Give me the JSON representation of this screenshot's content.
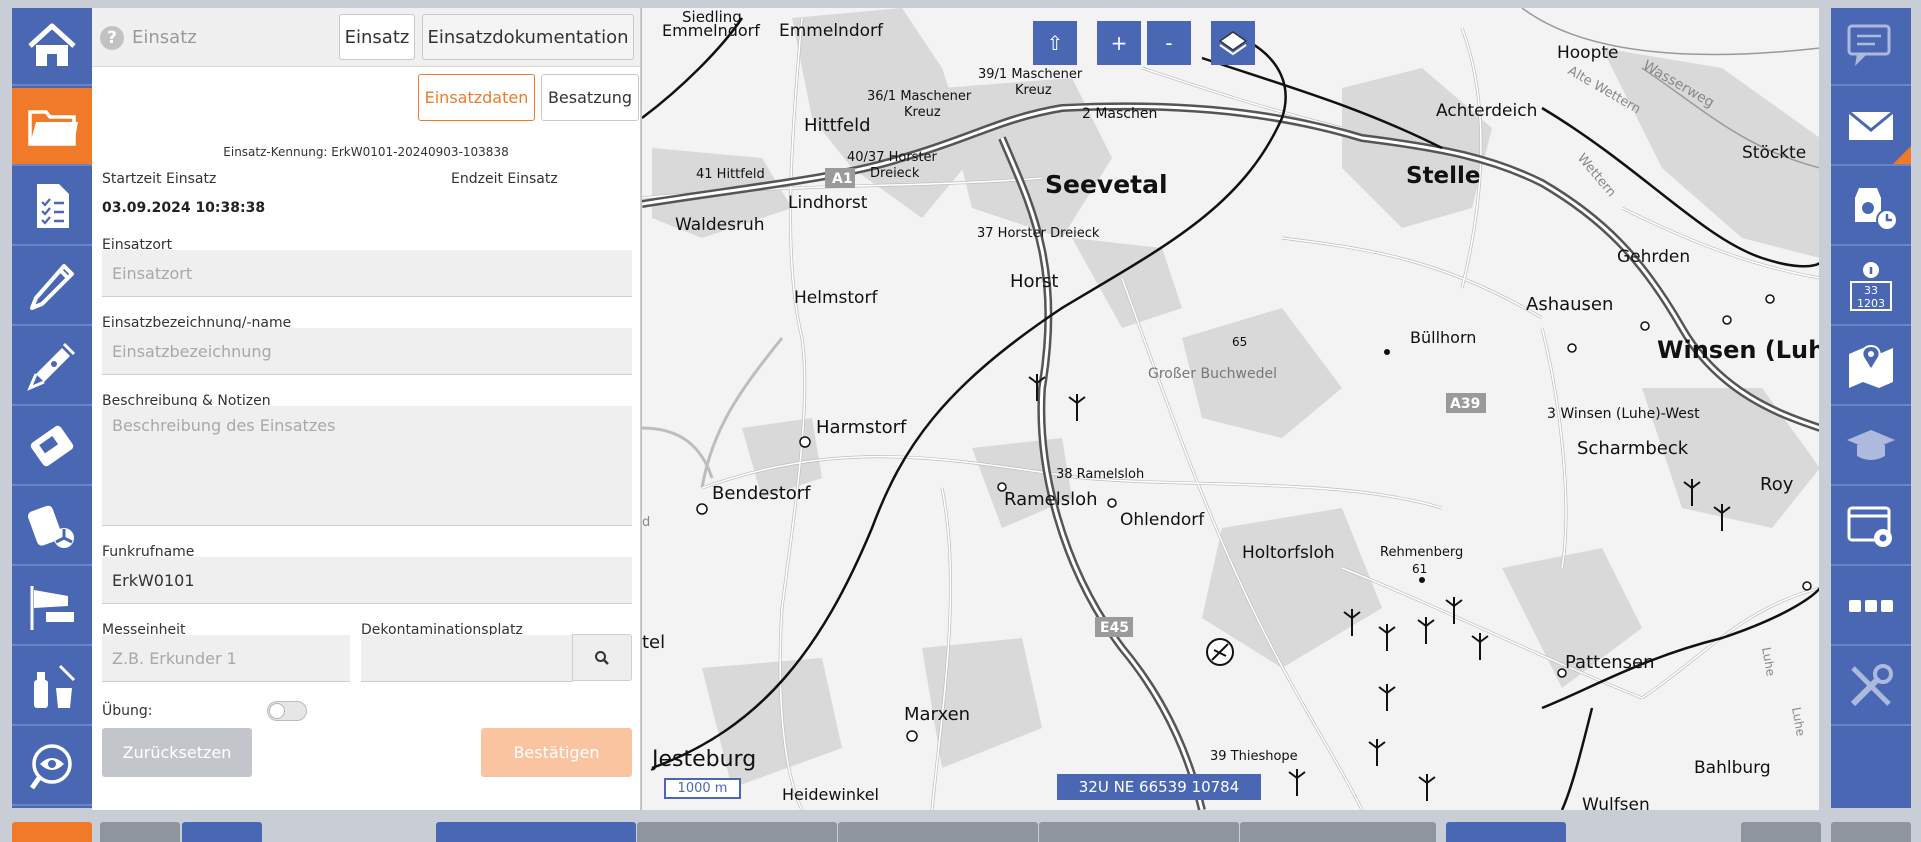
{
  "header": {
    "title": "Einsatz",
    "tab_einsatz": "Einsatz",
    "tab_dokumentation": "Einsatzdokumentation"
  },
  "subtabs": {
    "einsatzdaten": "Einsatzdaten",
    "besatzung": "Besatzung"
  },
  "form": {
    "kennung": "Einsatz-Kennung: ErkW0101-20240903-103838",
    "startzeit_label": "Startzeit Einsatz",
    "startzeit_value": "03.09.2024 10:38:38",
    "endzeit_label": "Endzeit Einsatz",
    "einsatzort_label": "Einsatzort",
    "einsatzort_placeholder": "Einsatzort",
    "bezeichnung_label": "Einsatzbezeichnung/-name",
    "bezeichnung_placeholder": "Einsatzbezeichnung",
    "beschreibung_label": "Beschreibung & Notizen",
    "beschreibung_placeholder": "Beschreibung des Einsatzes",
    "funkrufname_label": "Funkrufname",
    "funkrufname_value": "ErkW0101",
    "messeinheit_label": "Messeinheit",
    "messeinheit_placeholder": "Z.B. Erkunder 1",
    "dekon_label": "Dekontaminationsplatz",
    "uebung_label": "Übung:",
    "reset_label": "Zurücksetzen",
    "confirm_label": "Bestätigen"
  },
  "map": {
    "btn_north": "⇧",
    "btn_zoom_in": "+",
    "btn_zoom_out": "-",
    "scale": "1000 m",
    "coordinate": "32U NE 66539 10784",
    "labels": {
      "sieding": "Siedling",
      "emmelndorf_a": "Emmelndorf",
      "emmelndorf_b": "Emmelndorf",
      "maschener_kreuz_a": "39/1 Maschener",
      "maschener_kreuz_b": "Kreuz",
      "maschener_361_a": "36/1 Maschener",
      "maschener_361_b": "Kreuz",
      "maschen_2": "2 Maschen",
      "hittfeld": "Hittfeld",
      "horster_4037_a": "40/37 Horster",
      "horster_4037_b": "Dreieck",
      "hittfeld_41": "41 Hittfeld",
      "a1": "A1",
      "lindhorst": "Lindhorst",
      "seevetal": "Seevetal",
      "horster_37": "37 Horster Dreieck",
      "waldesruh": "Waldesruh",
      "horst": "Horst",
      "helmstorf": "Helmstorf",
      "hoehe_65": "65",
      "grosser_buchwedel": "Großer Buchwedel",
      "harmstorf": "Harmstorf",
      "ramelsloh_38": "38 Ramelsloh",
      "ramelsloh": "Ramelsloh",
      "ohlendorf": "Ohlendorf",
      "bendestorf": "Bendestorf",
      "holtorfsloh": "Holtorfsloh",
      "rehmenberg": "Rehmenberg",
      "hoehe_61": "61",
      "e45": "E45",
      "marxen": "Marxen",
      "jesteburg": "Jesteburg",
      "heidewinkel": "Heidewinkel",
      "thieshope_39": "39 Thieshope",
      "stelle": "Stelle",
      "achterdeich": "Achterdeich",
      "hoopte": "Hoopte",
      "stoeckte": "Stöckte",
      "alte_wettern": "Alte Wettern",
      "wettern": "Wettern",
      "wasserweg": "Wasserweg",
      "gehrden": "Gehrden",
      "ashausen": "Ashausen",
      "buellhorn": "Büllhorn",
      "winsen": "Winsen (Luhe",
      "a39": "A39",
      "winsen_west": "3 Winsen (Luhe)-West",
      "scharmbeck": "Scharmbeck",
      "roy": "Roy",
      "pattensen": "Pattensen",
      "bahlburg": "Bahlburg",
      "wulfsen": "Wulfsen",
      "luhe": "Luhe",
      "luhe_b": "Luhe",
      "tel": "tel",
      "d": "d"
    }
  },
  "colors": {
    "primary": "#4a67b4",
    "accent": "#f07a2a",
    "accent_light": "#fbc4a0"
  }
}
